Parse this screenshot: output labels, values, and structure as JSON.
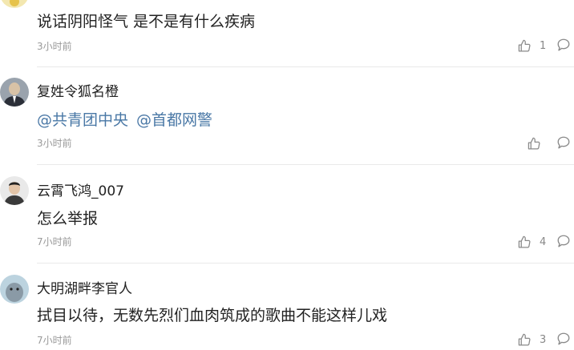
{
  "comments": [
    {
      "user": "",
      "text": "说话阴阳怪气 是不是有什么疾病",
      "time": "3小时前",
      "likes": "1"
    },
    {
      "user": "复姓令狐名橙",
      "mentions": [
        "@共青团中央",
        "@首都网警"
      ],
      "time": "3小时前",
      "likes": ""
    },
    {
      "user": "云霄飞鸿_007",
      "text": "怎么举报",
      "time": "7小时前",
      "likes": "4"
    },
    {
      "user": "大明湖畔李官人",
      "text": "拭目以待，无数先烈们血肉筑成的歌曲不能这样儿戏",
      "time": "7小时前",
      "likes": "3"
    }
  ],
  "icons": {
    "like": "thumbs-up-icon",
    "reply": "speech-bubble-icon"
  }
}
